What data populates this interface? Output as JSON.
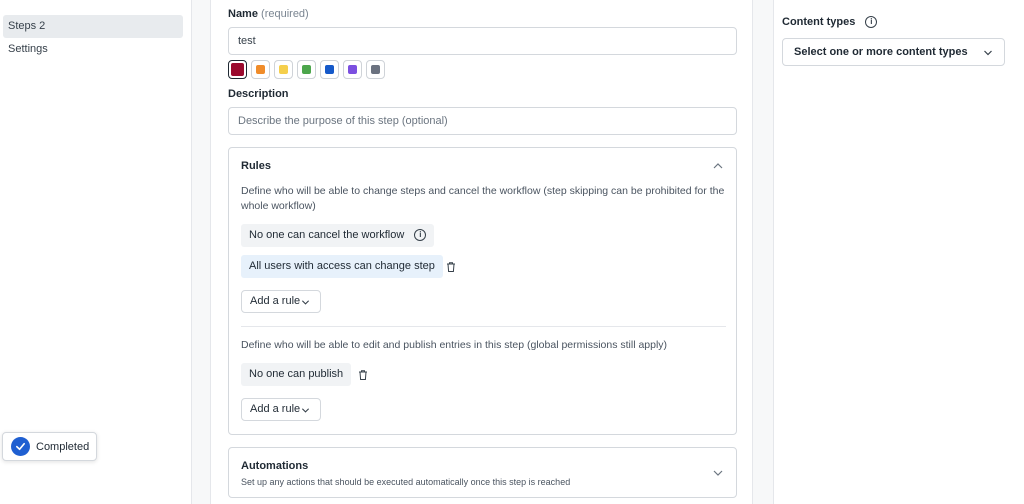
{
  "sidebar": {
    "items": [
      {
        "label": "Steps 2",
        "active": true
      },
      {
        "label": "Settings",
        "active": false
      }
    ]
  },
  "toast": {
    "label": "Completed",
    "icon": "check-circle-icon"
  },
  "form": {
    "name_label": "Name",
    "name_hint": "(required)",
    "name_value": "test",
    "colors": [
      {
        "hex": "#9b0a2e",
        "selected": true
      },
      {
        "hex": "#f08c2a",
        "selected": false
      },
      {
        "hex": "#f5cf4c",
        "selected": false
      },
      {
        "hex": "#4ca64c",
        "selected": false
      },
      {
        "hex": "#1559c9",
        "selected": false
      },
      {
        "hex": "#7b4fe0",
        "selected": false
      },
      {
        "hex": "#6b7280",
        "selected": false
      }
    ],
    "description_label": "Description",
    "description_placeholder": "Describe the purpose of this step (optional)"
  },
  "rules": {
    "title": "Rules",
    "intro": "Define who will be able to change steps and cancel the workflow (step skipping can be prohibited for the whole workflow)",
    "cancel_rule": "No one can cancel the workflow",
    "change_rule": "All users with access can change step",
    "add_rule_label": "Add a rule",
    "publish_intro": "Define who will be able to edit and publish entries in this step (global permissions still apply)",
    "publish_rule": "No one can publish",
    "add_rule_label_2": "Add a rule"
  },
  "automations": {
    "title": "Automations",
    "subtitle": "Set up any actions that should be executed automatically once this step is reached"
  },
  "content_types": {
    "label": "Content types",
    "placeholder": "Select one or more content types"
  }
}
